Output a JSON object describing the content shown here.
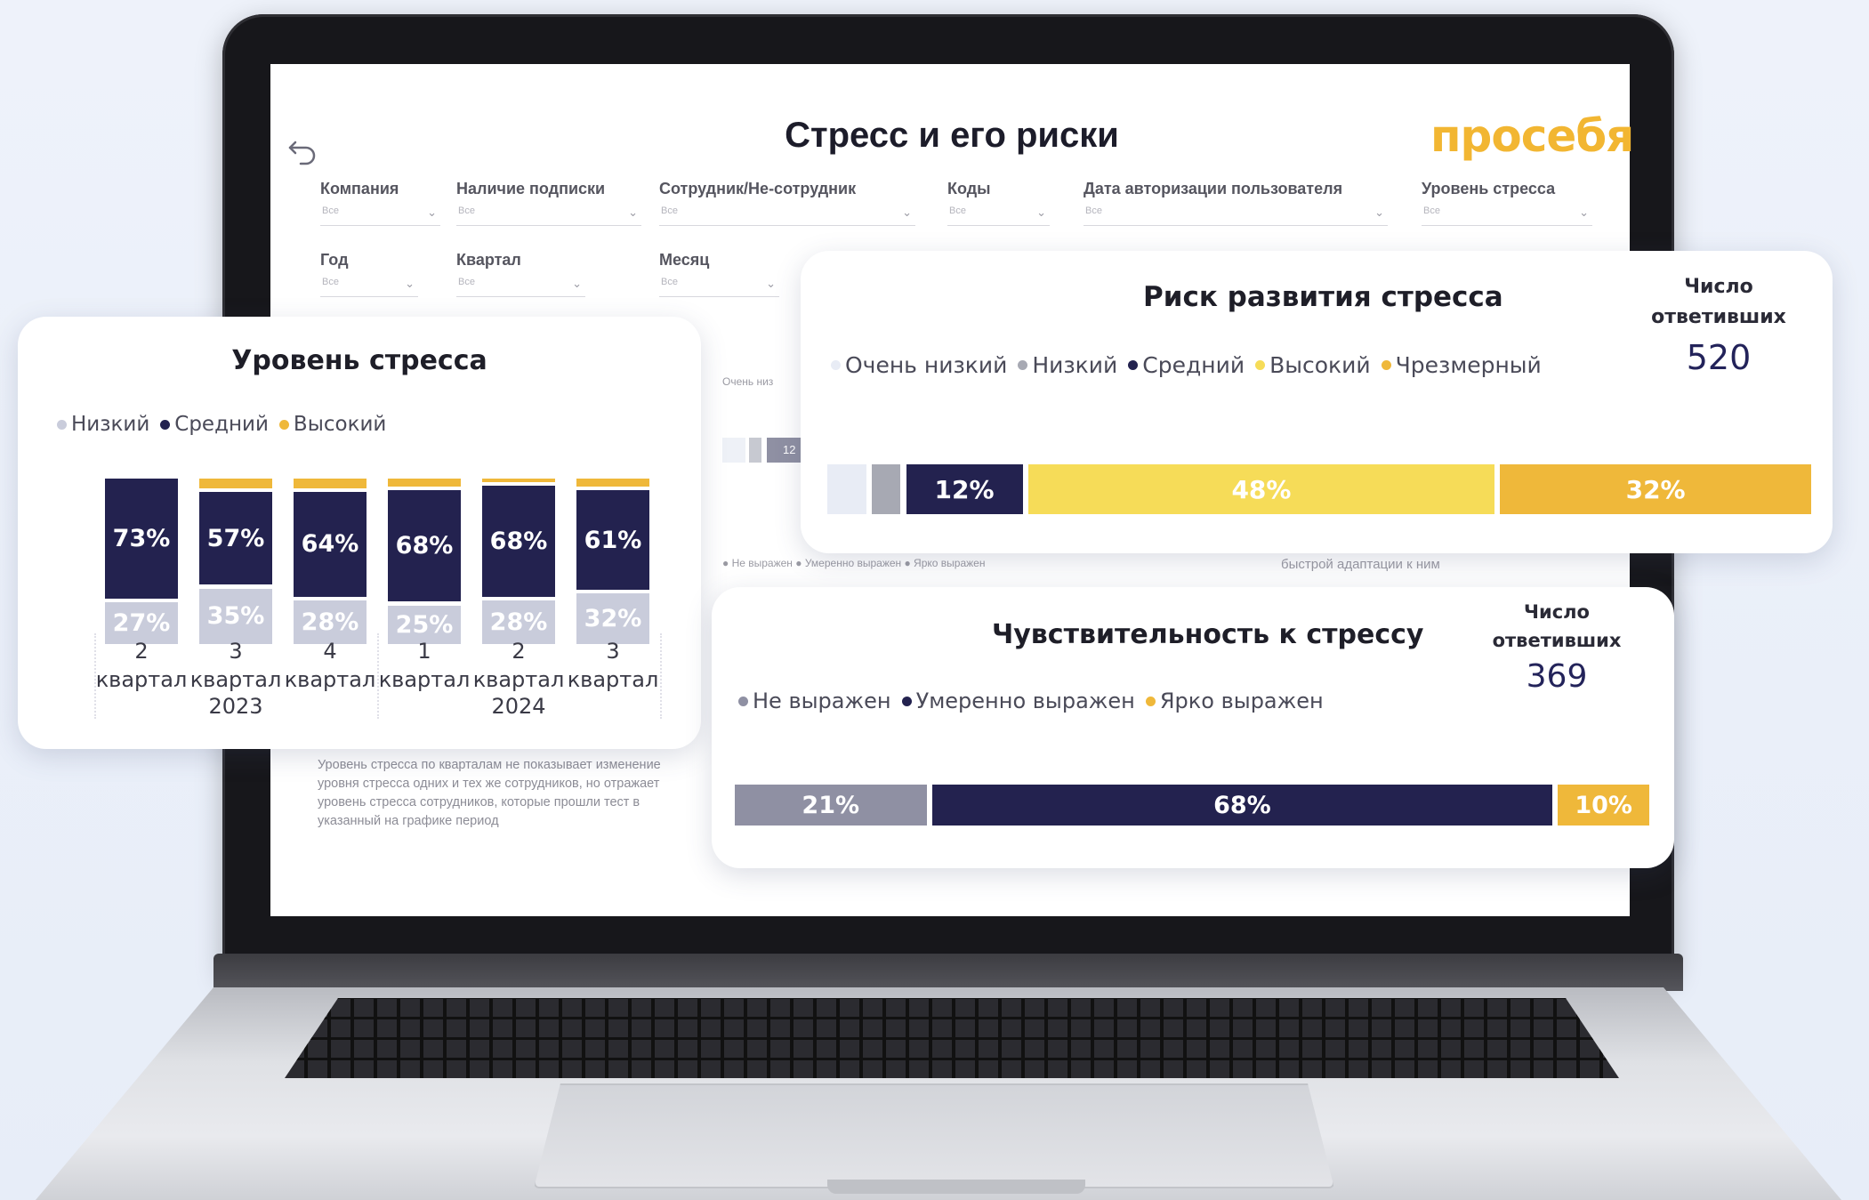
{
  "dashboard": {
    "title": "Стресс и его риски",
    "brand": "просебя",
    "filters": [
      {
        "label": "Компания",
        "value": "Все"
      },
      {
        "label": "Наличие подписки",
        "value": "Все"
      },
      {
        "label": "Сотрудник/Не-сотрудник",
        "value": "Все"
      },
      {
        "label": "Коды",
        "value": "Все"
      },
      {
        "label": "Дата авторизации пользователя",
        "value": "Все"
      },
      {
        "label": "Уровень стресса",
        "value": "Все"
      },
      {
        "label": "Год",
        "value": "Все"
      },
      {
        "label": "Квартал",
        "value": "Все"
      },
      {
        "label": "Месяц",
        "value": "Все"
      }
    ],
    "note": "Уровень стресса по кварталам не показывает изменение уровня стресса одних и тех же сотрудников, но отражает уровень стресса сотрудников, которые прошли тест в указанный на графике период",
    "small_texts": {
      "very_low": "Очень низ",
      "legend_sens": "● Не выражен ● Умеренно выражен ● Ярко выражен",
      "adapt": "быстрой адаптации к ним",
      "ghost_pct": "12"
    }
  },
  "colors": {
    "navy": "#23224f",
    "light": "#c9ccdb",
    "yellow": "#f6dc58",
    "orange": "#efb83a",
    "very_low": "#e8ecf5",
    "low_grey": "#a7a9b3",
    "sens_grey": "#8f90a3"
  },
  "stress_level_card": {
    "title": "Уровень стресса",
    "legend": [
      "Низкий",
      "Средний",
      "Высокий"
    ],
    "chart_data": {
      "type": "bar",
      "stacked": true,
      "title": "Уровень стресса",
      "categories": [
        "2 квартал 2023",
        "3 квартал 2023",
        "4 квартал 2023",
        "1 квартал 2024",
        "2 квартал 2024",
        "3 квартал 2024"
      ],
      "series": [
        {
          "name": "Низкий",
          "values": [
            27,
            35,
            28,
            25,
            28,
            32
          ]
        },
        {
          "name": "Средний",
          "values": [
            73,
            57,
            64,
            68,
            68,
            61
          ]
        },
        {
          "name": "Высокий",
          "values": [
            0,
            8,
            8,
            7,
            4,
            7
          ]
        }
      ],
      "x_tick_top": [
        "2",
        "3",
        "4",
        "1",
        "2",
        "3"
      ],
      "x_tick_mid": [
        "квартал",
        "квартал",
        "квартал",
        "квартал",
        "квартал",
        "квартал"
      ],
      "x_groups": [
        "2023",
        "2024"
      ]
    }
  },
  "risk_card": {
    "title": "Риск развития стресса",
    "respondents_label_1": "Число",
    "respondents_label_2": "ответивших",
    "respondents_value": "520",
    "legend": [
      "Очень низкий",
      "Низкий",
      "Средний",
      "Высокий",
      "Чрезмерный"
    ],
    "chart_data": {
      "type": "bar",
      "stacked": true,
      "title": "Риск развития стресса",
      "series": [
        {
          "name": "Очень низкий",
          "value": 4
        },
        {
          "name": "Низкий",
          "value": 3
        },
        {
          "name": "Средний",
          "value": 12,
          "label": "12%"
        },
        {
          "name": "Высокий",
          "value": 48,
          "label": "48%"
        },
        {
          "name": "Чрезмерный",
          "value": 32,
          "label": "32%"
        }
      ]
    }
  },
  "sensitivity_card": {
    "title": "Чувствительность к стрессу",
    "respondents_label_1": "Число",
    "respondents_label_2": "ответивших",
    "respondents_value": "369",
    "legend": [
      "Не выражен",
      "Умеренно выражен",
      "Ярко выражен"
    ],
    "chart_data": {
      "type": "bar",
      "stacked": true,
      "title": "Чувствительность к стрессу",
      "series": [
        {
          "name": "Не выражен",
          "value": 21,
          "label": "21%"
        },
        {
          "name": "Умеренно выражен",
          "value": 68,
          "label": "68%"
        },
        {
          "name": "Ярко выражен",
          "value": 10,
          "label": "10%"
        }
      ]
    }
  }
}
